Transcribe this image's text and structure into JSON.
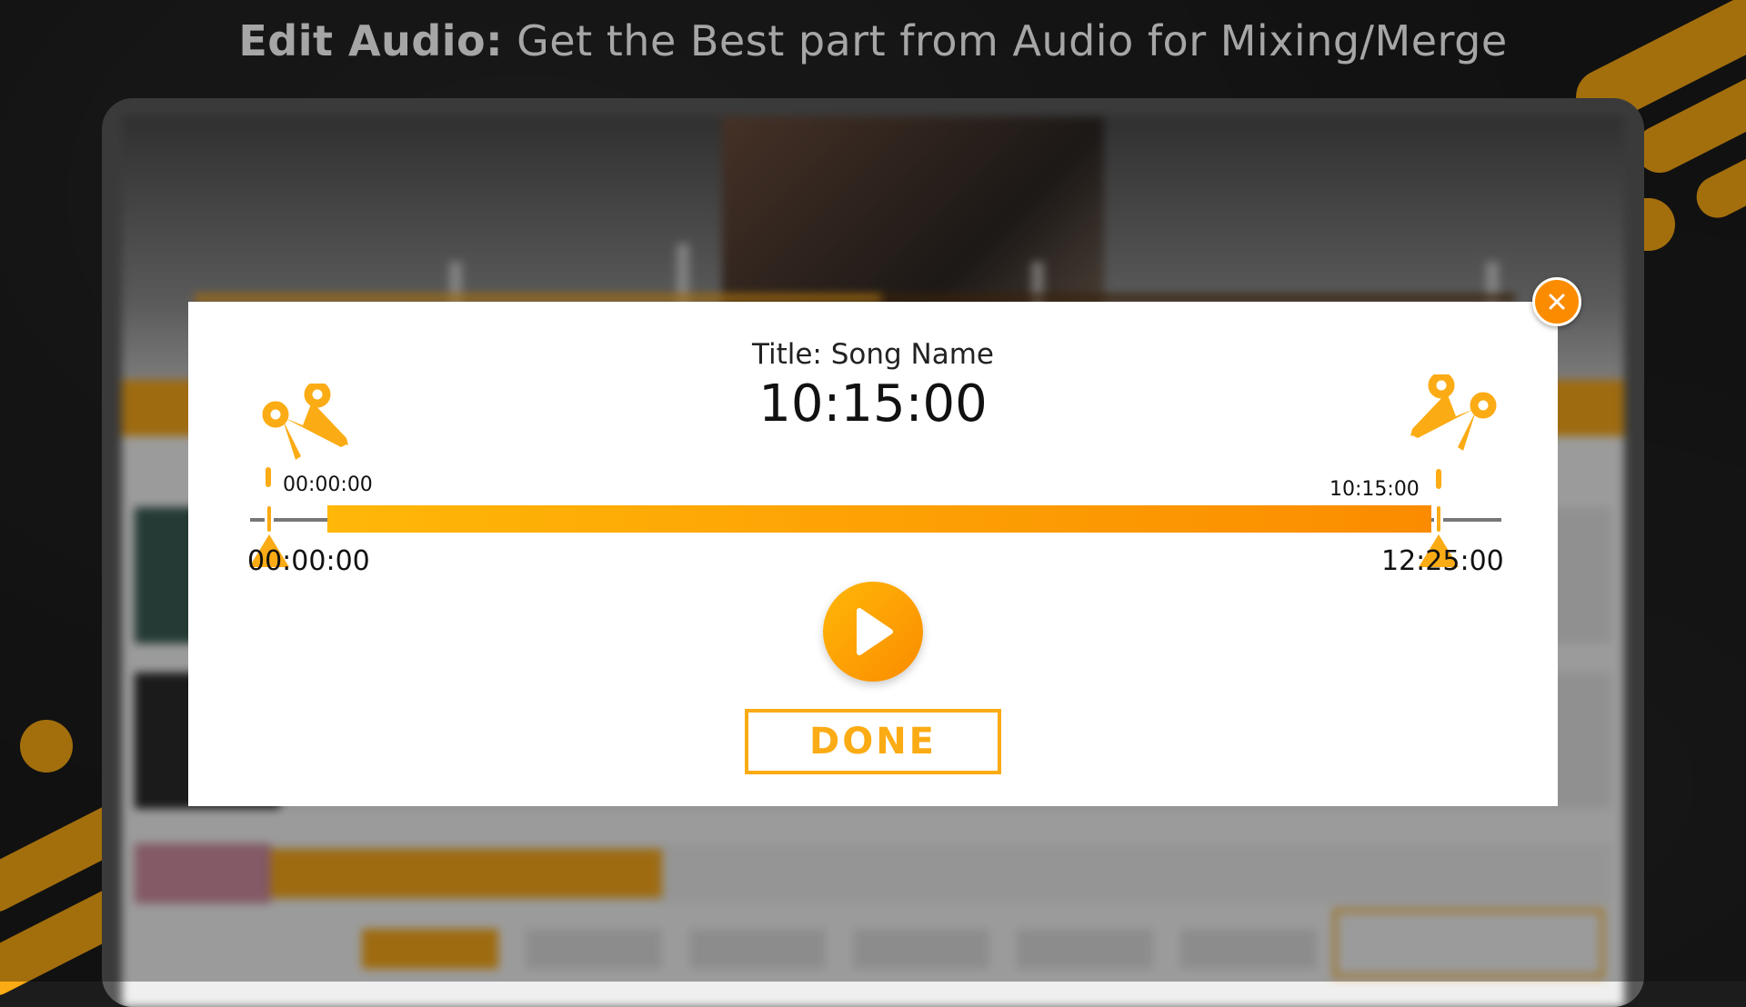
{
  "headline": {
    "bold": "Edit Audio:",
    "rest": " Get the Best part from Audio for Mixing/Merge"
  },
  "modal": {
    "title_label": "Title: Song Name",
    "duration": "10:15:00",
    "trim_start_small": "00:00:00",
    "trim_end_small": "10:15:00",
    "track_start": "00:00:00",
    "track_end": "12:25:00",
    "done_label": "DONE"
  },
  "colors": {
    "accent": "#fbab14",
    "accent_dark": "#fb8c00",
    "background": "#1b1b1b"
  },
  "icons": {
    "close": "close-icon",
    "play": "play-icon",
    "scissors_left": "scissors-icon",
    "scissors_right": "scissors-icon"
  }
}
